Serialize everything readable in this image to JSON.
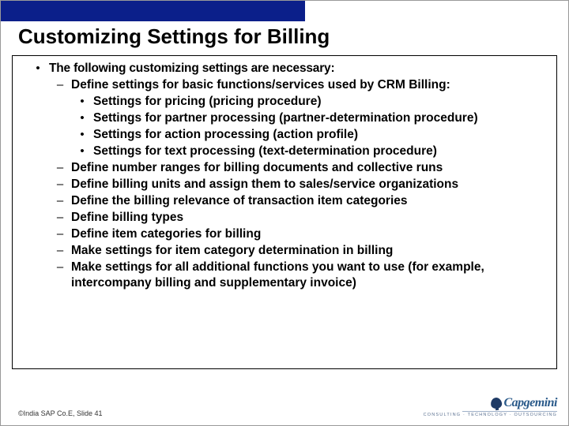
{
  "title": "Customizing Settings for Billing",
  "lead": "The following customizing settings are necessary:",
  "d1": {
    "text": "Define settings for basic functions/services used by CRM Billing:",
    "s1": "Settings for pricing (pricing procedure)",
    "s2": "Settings for partner processing (partner-determination procedure)",
    "s3": "Settings for action processing (action profile)",
    "s4": "Settings for text processing (text-determination procedure)"
  },
  "d2": "Define number ranges for billing documents and collective runs",
  "d3": "Define billing units and assign them to sales/service organizations",
  "d4": "Define the billing relevance of transaction item categories",
  "d5": "Define billing types",
  "d6": "Define item categories for billing",
  "d7": "Make settings for item category determination in billing",
  "d8": "Make settings for all additional functions you want to use (for example, intercompany billing and supplementary invoice)",
  "footer": "©India SAP Co.E, Slide 41",
  "logo": {
    "name": "Capgemini",
    "tag": "CONSULTING · TECHNOLOGY · OUTSOURCING"
  },
  "bullets": {
    "dot": "•",
    "dash": "–"
  }
}
